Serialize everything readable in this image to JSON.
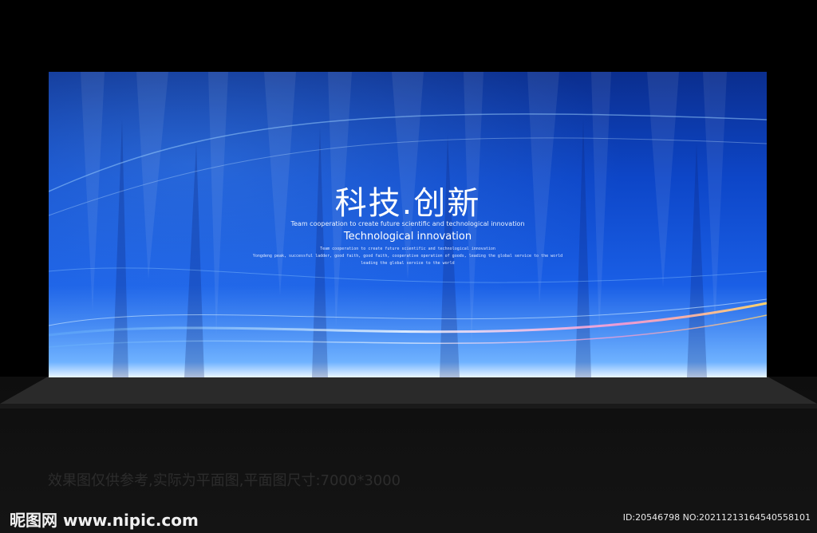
{
  "banner": {
    "title": "科技.创新",
    "tagline_small": "Team cooperation to create future scientific and technological innovation",
    "tagline_main": "Technological innovation",
    "body_lines": [
      "Team cooperation to create future scientific and technological innovation",
      "Yongdeng peak, successful ladder, good faith, good faith, cooperative operation of goods, leading the global service to the world",
      "leading the global service to the world"
    ]
  },
  "caption": "效果图仅供参考,实际为平面图,平面图尺寸:7000*3000",
  "watermark": {
    "logo": "昵图网 www.nipic.com",
    "id_line": "ID:20546798 NO:20211213164540558101"
  },
  "colors": {
    "board_dark": "#0b2e8e",
    "board_mid": "#1a5fe6",
    "board_light": "#e9f6ff",
    "glow": "#ffb347"
  }
}
